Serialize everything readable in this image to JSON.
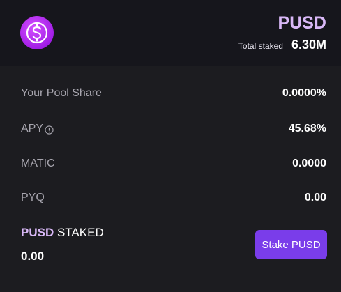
{
  "header": {
    "logo_icon": "dollar-sign-icon",
    "token_name": "PUSD",
    "total_staked_label": "Total staked",
    "total_staked_value": "6.30M"
  },
  "stats": [
    {
      "label": "Your Pool Share",
      "value": "0.0000%"
    },
    {
      "label": "APY",
      "value": "45.68%",
      "icon": "info-icon"
    },
    {
      "label": "MATIC",
      "value": "0.0000"
    },
    {
      "label": "PYQ",
      "value": "0.00"
    }
  ],
  "staking": {
    "token": "PUSD",
    "title_suffix": "STAKED",
    "amount": "0.00",
    "button_label": "Stake PUSD"
  },
  "colors": {
    "background": "#1c1c20",
    "header_background": "#16161c",
    "accent": "#7a3dea",
    "token_color": "#d9b8f7"
  }
}
